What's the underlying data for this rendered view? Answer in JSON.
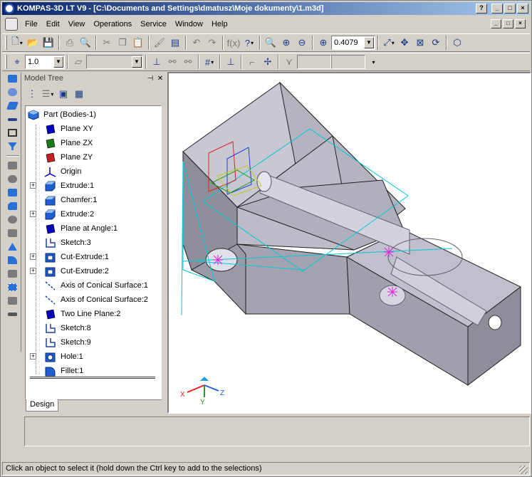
{
  "window": {
    "title": "KOMPAS-3D LT V9 - [C:\\Documents and Settings\\dmatusz\\Moje dokumenty\\1.m3d]",
    "controls": {
      "minimize": "_",
      "maximize": "□",
      "close": "×"
    }
  },
  "menu": {
    "items": [
      "File",
      "Edit",
      "View",
      "Operations",
      "Service",
      "Window",
      "Help"
    ]
  },
  "toolbar": {
    "zoom_value": "0.4079",
    "step_value": "1.0"
  },
  "model_tree": {
    "title": "Model Tree",
    "tab_label": "Design",
    "root": "Part (Bodies-1)",
    "items": [
      {
        "label": "Plane XY",
        "expandable": false,
        "icon": "plane-icon",
        "color": "#0000c0"
      },
      {
        "label": "Plane ZX",
        "expandable": false,
        "icon": "plane-icon",
        "color": "#1a7a1a"
      },
      {
        "label": "Plane ZY",
        "expandable": false,
        "icon": "plane-icon",
        "color": "#c02020"
      },
      {
        "label": "Origin",
        "expandable": false,
        "icon": "origin-icon",
        "color": "#0000c0"
      },
      {
        "label": "Extrude:1",
        "expandable": true,
        "icon": "extrude-icon",
        "color": "#1f5fd0"
      },
      {
        "label": "Chamfer:1",
        "expandable": false,
        "icon": "chamfer-icon",
        "color": "#1f5fd0"
      },
      {
        "label": "Extrude:2",
        "expandable": true,
        "icon": "extrude-icon",
        "color": "#1f5fd0"
      },
      {
        "label": "Plane at Angle:1",
        "expandable": false,
        "icon": "plane-icon",
        "color": "#0000c0"
      },
      {
        "label": "Sketch:3",
        "expandable": false,
        "icon": "sketch-icon",
        "color": "#1f3f90"
      },
      {
        "label": "Cut-Extrude:1",
        "expandable": true,
        "icon": "cut-extrude-icon",
        "color": "#1f5fd0"
      },
      {
        "label": "Cut-Extrude:2",
        "expandable": true,
        "icon": "cut-extrude-icon",
        "color": "#1f5fd0"
      },
      {
        "label": "Axis of Conical Surface:1",
        "expandable": false,
        "icon": "axis-icon",
        "color": "#1f3f90"
      },
      {
        "label": "Axis of Conical Surface:2",
        "expandable": false,
        "icon": "axis-icon",
        "color": "#1f3f90"
      },
      {
        "label": "Two Line Plane:2",
        "expandable": false,
        "icon": "plane-icon",
        "color": "#0000c0"
      },
      {
        "label": "Sketch:8",
        "expandable": false,
        "icon": "sketch-icon",
        "color": "#1f3f90"
      },
      {
        "label": "Sketch:9",
        "expandable": false,
        "icon": "sketch-icon",
        "color": "#1f3f90"
      },
      {
        "label": "Hole:1",
        "expandable": true,
        "icon": "hole-icon",
        "color": "#1f5fd0"
      },
      {
        "label": "Fillet:1",
        "expandable": false,
        "icon": "fillet-icon",
        "color": "#1f5fd0"
      }
    ]
  },
  "axes_triad": {
    "x": "X",
    "y": "Y",
    "z": "Z"
  },
  "status": {
    "message": "Click an object to select it (hold down the Ctrl key to add to the selections)"
  },
  "colors": {
    "title_start": "#0a246a",
    "title_end": "#a6caf0",
    "model_face": "#b4b4c0",
    "model_edge": "#202020",
    "plane_cyan": "#00c8d8",
    "marker_magenta": "#e020e0"
  }
}
